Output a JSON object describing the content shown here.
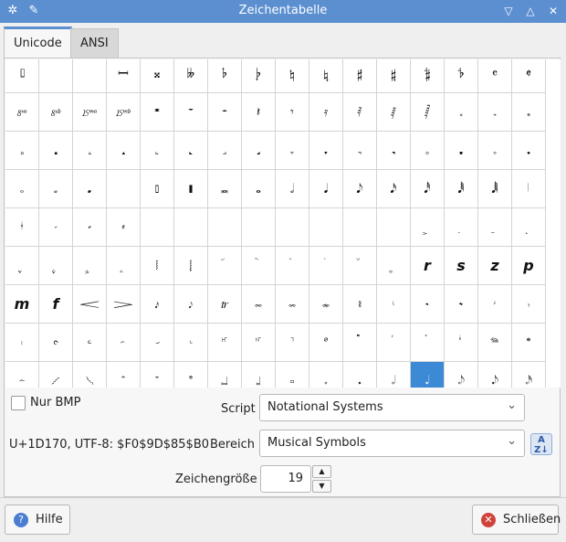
{
  "window": {
    "title": "Zeichentabelle"
  },
  "titlebar_icons": {
    "app": "gear-icon",
    "pin": "pin-icon",
    "minimize": "chevron-down-icon",
    "maximize": "chevron-up-icon",
    "close": "close-icon"
  },
  "tabs": [
    {
      "label": "Unicode",
      "active": true
    },
    {
      "label": "ANSI",
      "active": false
    }
  ],
  "grid": {
    "cells": [
      "𝄦",
      "𝄧",
      "𝄨",
      "𝄩",
      "𝄪",
      "𝄫",
      "𝄬",
      "𝄭",
      "𝄮",
      "𝄯",
      "𝄰",
      "𝄱",
      "𝄲",
      "𝄳",
      "𝄴",
      "𝄵",
      "𝄶",
      "𝄷",
      "𝄸",
      "𝄹",
      "𝄺",
      "𝄻",
      "𝄼",
      "𝄽",
      "𝄾",
      "𝄿",
      "𝅀",
      "𝅁",
      "𝅂",
      "𝅃",
      "𝅄",
      "𝅅",
      "𝅆",
      "𝅇",
      "𝅈",
      "𝅉",
      "𝅊",
      "𝅋",
      "𝅌",
      "𝅍",
      "𝅎",
      "𝅏",
      "𝅐",
      "𝅑",
      "𝅒",
      "𝅓",
      "𝅔",
      "𝅕",
      "𝅖",
      "𝅗",
      "𝅘",
      "𝅙",
      "𝅚",
      "𝅛",
      "𝅜",
      "𝅝",
      "𝅗𝅥",
      "𝅘𝅥",
      "𝅘𝅥𝅮",
      "𝅘𝅥𝅯",
      "𝅘𝅥𝅰",
      "𝅘𝅥𝅱",
      "𝅘𝅥𝅲",
      "𝅥",
      "𝅦",
      "𝅧",
      "𝅨",
      "𝅩",
      "",
      "",
      "",
      "",
      "",
      "",
      "",
      "",
      "𝅻",
      "𝅼",
      "𝅽",
      "𝅾",
      "𝅿",
      "𝆀",
      "𝆁",
      "𝆂",
      "𝆃",
      "𝆄",
      "𝆅",
      "𝆆",
      "𝆇",
      "𝆈",
      "𝆉",
      "𝆊",
      "r",
      "s",
      "z",
      "p",
      "m",
      "f",
      "𝆒",
      "𝆓",
      "𝆔",
      "𝆕",
      "𝆖",
      "𝆗",
      "𝆘",
      "𝆙",
      "𝆚",
      "𝆛",
      "𝆜",
      "𝆝",
      "𝆞",
      "𝆟",
      "𝆠",
      "𝆡",
      "𝆢",
      "𝆣",
      "𝆤",
      "𝆥",
      "𝆦",
      "𝆧",
      "𝆨",
      "𝆩",
      "𝆪",
      "𝆫",
      "𝆬",
      "𝆭",
      "𝆮",
      "𝆯",
      "𝆰",
      "𝆱",
      "𝆲",
      "𝆳",
      "𝆴",
      "𝆵",
      "𝆶",
      "𝆷",
      "𝆸",
      "𝆹",
      "𝆺",
      "𝆹𝅥",
      "𝆺𝅥",
      "𝆹𝅥𝅮",
      "𝆺𝅥𝅮",
      "𝆹𝅥𝅯"
    ],
    "selected_index": 140
  },
  "controls": {
    "nur_bmp_label": "Nur BMP",
    "script_label": "Script",
    "script_value": "Notational Systems",
    "code_info": "U+1D170, UTF-8: $F0$9D$85$B0",
    "bereich_label": "Bereich",
    "bereich_value": "Musical Symbols",
    "sort_icon": "sort-az-icon",
    "sort_text": "A\nZ↓",
    "size_label": "Zeichengröße",
    "size_value": "19"
  },
  "buttons": {
    "help_label": "Hilfe",
    "help_icon": "help-icon",
    "close_label": "Schließen",
    "close_icon": "close-icon"
  },
  "colors": {
    "titlebar": "#5b8fd0",
    "selection": "#3c89d6"
  }
}
